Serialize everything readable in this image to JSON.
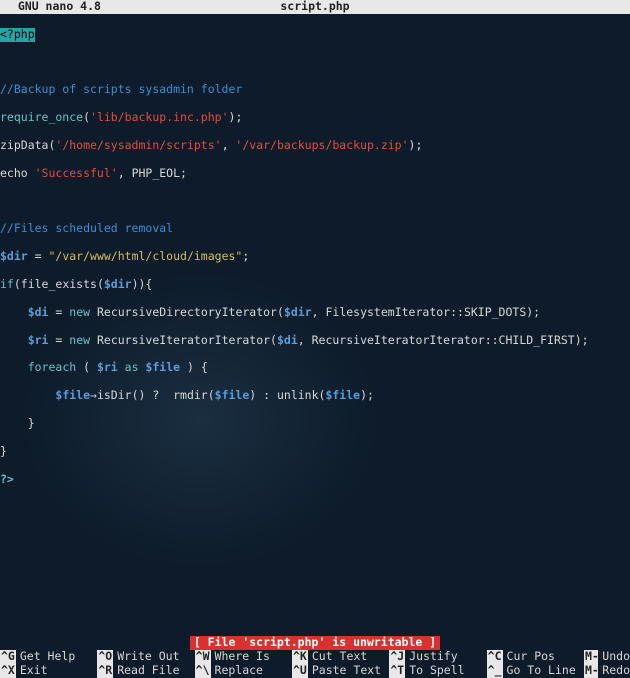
{
  "title": {
    "app": "GNU nano 4.8",
    "file": "script.php"
  },
  "code": {
    "php_open": "<?php",
    "l1_comment": "//Backup of scripts sysadmin folder",
    "l2_require": "require_once",
    "l2_p1": "(",
    "l2_str": "'lib/backup.inc.php'",
    "l2_p2": ");",
    "l3_fn": "zipData(",
    "l3_str1": "'/home/sysadmin/scripts'",
    "l3_mid": ", ",
    "l3_str2": "'/var/backups/backup.zip'",
    "l3_end": ");",
    "l4_a": "echo ",
    "l4_str": "'Successful'",
    "l4_b": ", PHP_EOL;",
    "l5_comment": "//Files scheduled removal",
    "l6_var": "$dir",
    "l6_eq": " = ",
    "l6_str": "\"/var/www/html/cloud/images\"",
    "l6_end": ";",
    "l7_a": "if",
    "l7_b": "(file_exists(",
    "l7_var": "$dir",
    "l7_c": ")){",
    "l8_ind": "    ",
    "l8_var": "$di",
    "l8_eq": " = ",
    "l8_new": "new",
    "l8_cls": " RecursiveDirectoryIterator(",
    "l8_arg": "$dir",
    "l8_rest": ", FilesystemIterator::SKIP_DOTS);",
    "l9_var": "$ri",
    "l9_cls": " RecursiveIteratorIterator(",
    "l9_arg": "$di",
    "l9_rest": ", RecursiveIteratorIterator::CHILD_FIRST);",
    "l10_foreach": "foreach",
    "l10_a": " ( ",
    "l10_v1": "$ri",
    "l10_as": " as ",
    "l10_v2": "$file",
    "l10_b": " ) {",
    "l11_ind": "        ",
    "l11_v": "$file",
    "l11_arrow": "→",
    "l11_a": "isDir() ?  rmdir(",
    "l11_v2": "$file",
    "l11_b": ") : unlink(",
    "l11_v3": "$file",
    "l11_c": ");",
    "l12": "    }",
    "l13": "}",
    "php_close": "?>"
  },
  "status": "[ File 'script.php' is unwritable ]",
  "shortcuts": [
    {
      "k": "^G",
      "l": "Get Help"
    },
    {
      "k": "^O",
      "l": "Write Out"
    },
    {
      "k": "^W",
      "l": "Where Is"
    },
    {
      "k": "^K",
      "l": "Cut Text"
    },
    {
      "k": "^J",
      "l": "Justify"
    },
    {
      "k": "^C",
      "l": "Cur Pos"
    },
    {
      "k": "M-U",
      "l": "Undo"
    },
    {
      "k": "^X",
      "l": "Exit"
    },
    {
      "k": "^R",
      "l": "Read File"
    },
    {
      "k": "^\\",
      "l": "Replace"
    },
    {
      "k": "^U",
      "l": "Paste Text"
    },
    {
      "k": "^T",
      "l": "To Spell"
    },
    {
      "k": "^_",
      "l": "Go To Line"
    },
    {
      "k": "M-E",
      "l": "Redo"
    }
  ]
}
